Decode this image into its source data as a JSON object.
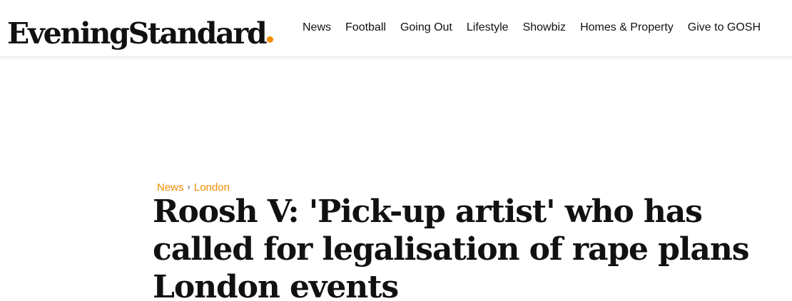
{
  "header": {
    "logo": {
      "text": "EveningStandard",
      "dot_color": "#f28c00"
    },
    "nav": [
      {
        "label": "News"
      },
      {
        "label": "Football"
      },
      {
        "label": "Going Out"
      },
      {
        "label": "Lifestyle"
      },
      {
        "label": "Showbiz"
      },
      {
        "label": "Homes & Property"
      },
      {
        "label": "Give to GOSH"
      }
    ]
  },
  "article": {
    "breadcrumb": [
      {
        "label": "News"
      },
      {
        "label": "London"
      }
    ],
    "breadcrumb_separator": "›",
    "headline": "Roosh V: 'Pick-up artist' who has called for legalisation of rape plans London events"
  },
  "colors": {
    "accent": "#f28c00",
    "text": "#111111",
    "background": "#ffffff"
  }
}
